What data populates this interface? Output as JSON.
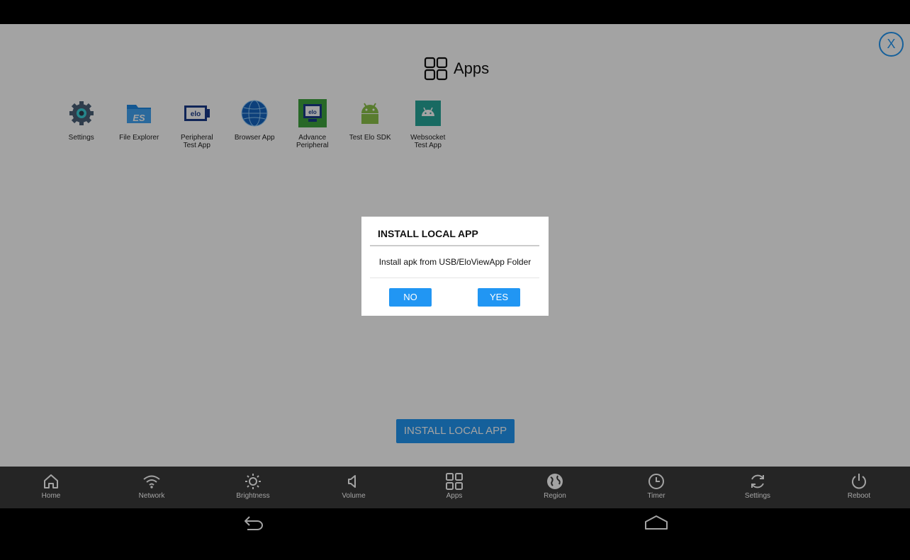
{
  "header": {
    "title": "Apps",
    "close_label": "X"
  },
  "apps": [
    {
      "label": "Settings",
      "icon": "gear-icon"
    },
    {
      "label": "File Explorer",
      "icon": "file-explorer-icon"
    },
    {
      "label": "Peripheral\nTest App",
      "icon": "elo-peripheral-icon"
    },
    {
      "label": "Browser App",
      "icon": "globe-icon"
    },
    {
      "label": "Advance\nPeripheral",
      "icon": "elo-advance-icon"
    },
    {
      "label": "Test Elo SDK",
      "icon": "android-icon"
    },
    {
      "label": "Websocket\nTest App",
      "icon": "android-box-icon"
    }
  ],
  "install_button": {
    "label": "INSTALL LOCAL APP"
  },
  "bottom_tabs": [
    {
      "label": "Home",
      "icon": "home-icon"
    },
    {
      "label": "Network",
      "icon": "wifi-icon"
    },
    {
      "label": "Brightness",
      "icon": "brightness-icon"
    },
    {
      "label": "Volume",
      "icon": "volume-icon"
    },
    {
      "label": "Apps",
      "icon": "apps-grid-icon",
      "active": true
    },
    {
      "label": "Region",
      "icon": "globe-icon"
    },
    {
      "label": "Timer",
      "icon": "clock-icon"
    },
    {
      "label": "Settings",
      "icon": "sync-icon"
    },
    {
      "label": "Reboot",
      "icon": "power-icon"
    }
  ],
  "dialog": {
    "title": "INSTALL LOCAL APP",
    "message": "Install apk from USB/EloViewApp Folder",
    "no_label": "NO",
    "yes_label": "YES"
  },
  "colors": {
    "accent": "#2196f3",
    "bottom_bar": "#3a3a3a",
    "overlay": "rgba(0,0,0,0.36)"
  }
}
